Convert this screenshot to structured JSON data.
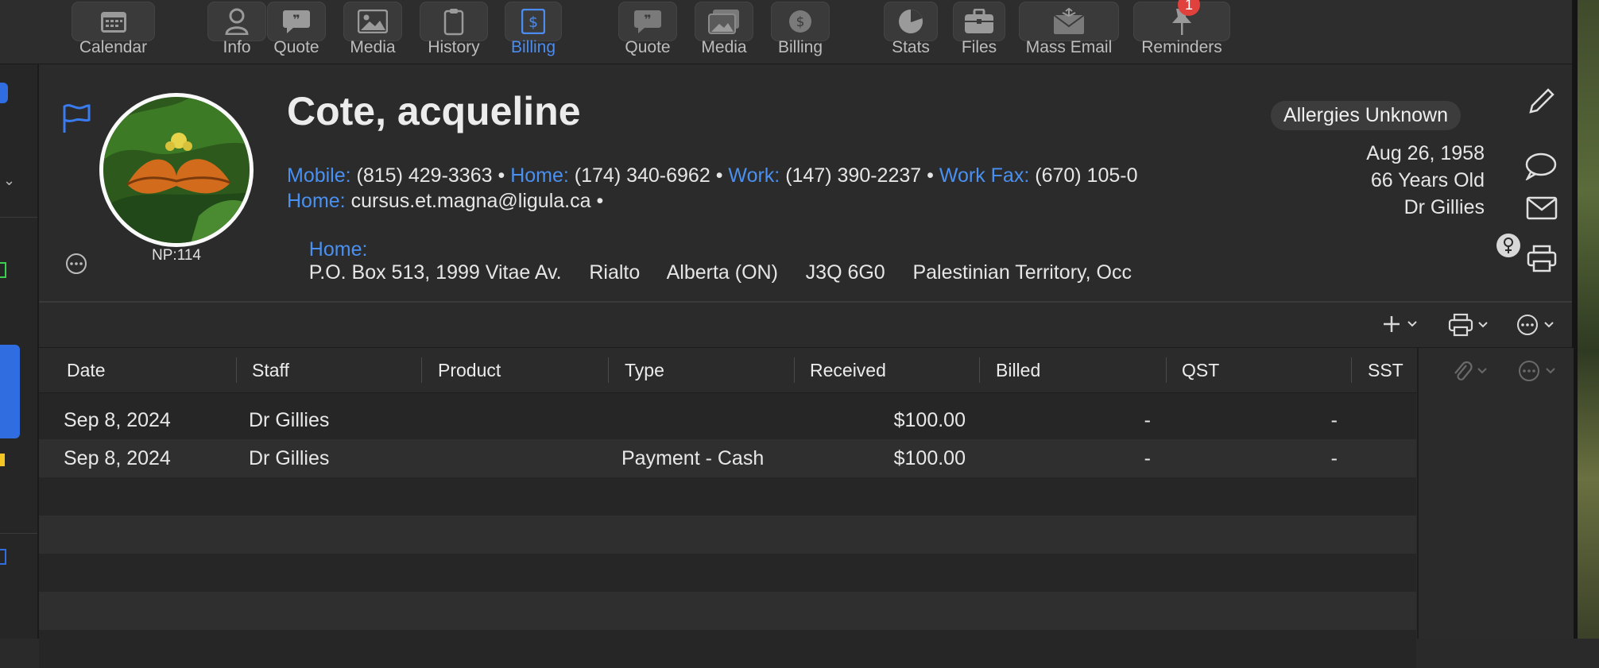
{
  "toolbar": {
    "items": [
      {
        "label": "Calendar",
        "icon": "calendar-icon"
      },
      {
        "label": "Info",
        "icon": "person-icon"
      },
      {
        "label": "Quote",
        "icon": "quote-bubble-icon"
      },
      {
        "label": "Media",
        "icon": "photo-icon"
      },
      {
        "label": "History",
        "icon": "clipboard-icon"
      },
      {
        "label": "Billing",
        "icon": "dollar-icon",
        "active": true
      },
      {
        "label": "Quote",
        "icon": "quote-bubble-icon"
      },
      {
        "label": "Media",
        "icon": "photos-icon"
      },
      {
        "label": "Billing",
        "icon": "dollar-icon"
      },
      {
        "label": "Stats",
        "icon": "pie-chart-icon"
      },
      {
        "label": "Files",
        "icon": "briefcase-icon"
      },
      {
        "label": "Mass Email",
        "icon": "envelope-icon"
      },
      {
        "label": "Reminders",
        "icon": "pin-icon",
        "badge": "1"
      }
    ]
  },
  "patient": {
    "name": "Cote, acqueline",
    "np": "NP:114",
    "phones": {
      "mobile_label": "Mobile:",
      "mobile": "(815) 429-3363",
      "home_label": "Home:",
      "home": "(174) 340-6962",
      "work_label": "Work:",
      "work": "(147) 390-2237",
      "workfax_label": "Work Fax:",
      "workfax": "(670) 105-0",
      "sep": "•"
    },
    "email_label": "Home:",
    "email": "cursus.et.magna@ligula.ca",
    "address_label": "Home:",
    "address": "P.O. Box 513, 1999 Vitae Av.     Rialto     Alberta (ON)     J3Q 6G0     Palestinian Territory, Occ",
    "allergies": "Allergies Unknown",
    "dob": "Aug 26, 1958",
    "age": "66 Years Old",
    "doctor": "Dr Gillies"
  },
  "table": {
    "headers": [
      "Date",
      "Staff",
      "Product",
      "Type",
      "Received",
      "Billed",
      "QST",
      "SST"
    ],
    "rows": [
      {
        "date": "Sep 8, 2024",
        "staff": "Dr Gillies",
        "product": "",
        "type": "",
        "received": "$100.00",
        "billed": "-",
        "qst": "-"
      },
      {
        "date": "Sep 8, 2024",
        "staff": "Dr Gillies",
        "product": "",
        "type": "Payment - Cash",
        "received": "$100.00",
        "billed": "-",
        "qst": "-"
      }
    ]
  },
  "colors": {
    "accent": "#4a8cf0",
    "badge": "#e0413c"
  }
}
